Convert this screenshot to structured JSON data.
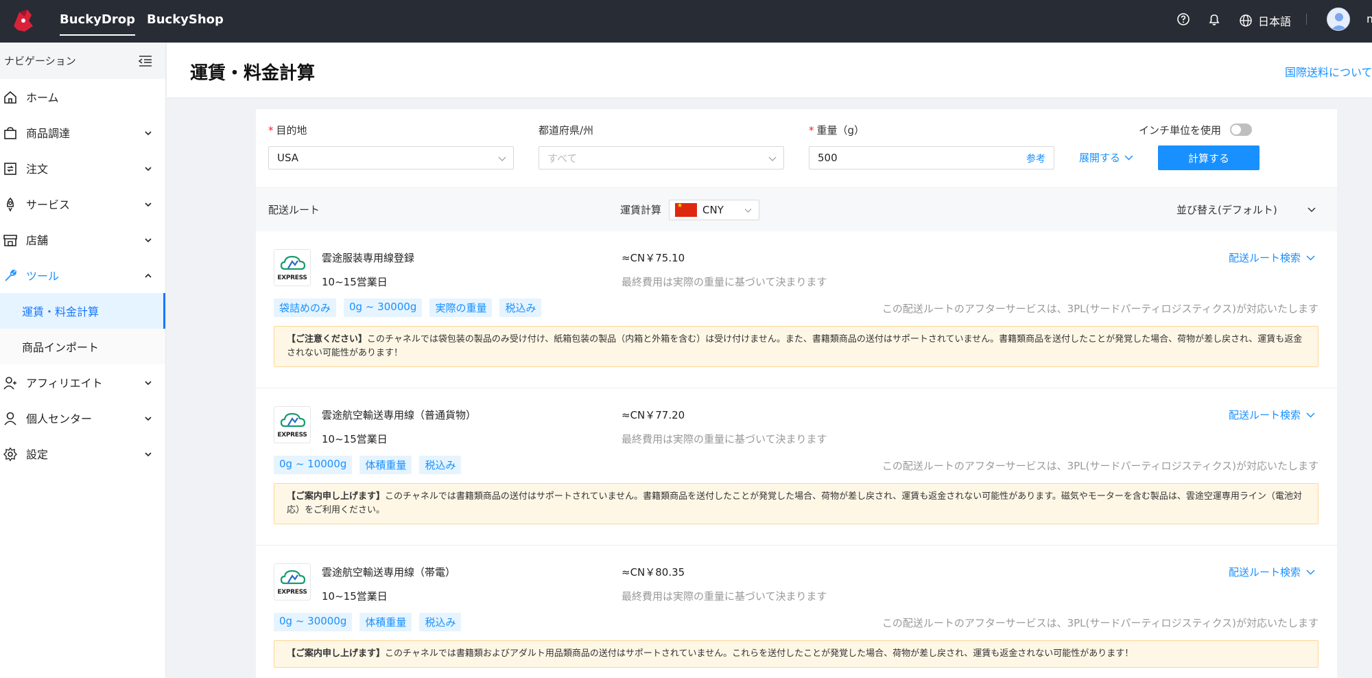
{
  "topbar": {
    "tabs": [
      {
        "label": "BuckyDrop"
      },
      {
        "label": "BuckyShop"
      }
    ],
    "language": "日本語",
    "user_initial": "m"
  },
  "sidebar": {
    "header": "ナビゲーション",
    "items": [
      {
        "label": "ホーム",
        "icon": "home-icon"
      },
      {
        "label": "商品調達",
        "icon": "shopping-bag-icon"
      },
      {
        "label": "注文",
        "icon": "order-icon"
      },
      {
        "label": "サービス",
        "icon": "rocket-icon"
      },
      {
        "label": "店舗",
        "icon": "store-icon"
      },
      {
        "label": "ツール",
        "icon": "wrench-icon"
      },
      {
        "label": "アフィリエイト",
        "icon": "affiliate-icon"
      },
      {
        "label": "個人センター",
        "icon": "user-icon"
      },
      {
        "label": "設定",
        "icon": "gear-icon"
      }
    ],
    "tools_sub": [
      {
        "label": "運賃・料金計算"
      },
      {
        "label": "商品インポート"
      }
    ]
  },
  "header": {
    "title": "運賃・料金計算",
    "link": "国際送料について書"
  },
  "form": {
    "destination_label": "目的地",
    "destination_value": "USA",
    "state_label": "都道府県/州",
    "state_placeholder": "すべて",
    "weight_label": "重量（g）",
    "weight_value": "500",
    "weight_ref": "参考",
    "inch_label": "インチ単位を使用",
    "expand_label": "展開する",
    "calc_button": "計算する"
  },
  "table": {
    "route_header": "配送ルート",
    "fee_header": "運賃計算",
    "currency": "CNY",
    "sort_label": "並び替え(デフォルト)"
  },
  "routes": [
    {
      "name": "雲途服装専用線登録",
      "days": "10~15営業日",
      "price": "≈CN￥75.10",
      "note": "最終費用は実際の重量に基づいて決まります",
      "search": "配送ルート検索",
      "tags": [
        "袋詰めのみ",
        "0g ~ 30000g",
        "実際の重量",
        "税込み"
      ],
      "after_service": "この配送ルートのアフターサービスは、3PL(サードパーティロジスティクス)が対応いたします",
      "notice_title": "【ご注意ください】",
      "notice_text": "このチャネルでは袋包装の製品のみ受け付け、紙箱包装の製品（内箱と外箱を含む）は受け付けません。また、書籍類商品の送付はサポートされていません。書籍類商品を送付したことが発覚した場合、荷物が差し戻され、運賃も返金されない可能性があります！",
      "logo_text": "EXPRESS"
    },
    {
      "name": "雲途航空輸送専用線（普通貨物）",
      "days": "10~15営業日",
      "price": "≈CN￥77.20",
      "note": "最終費用は実際の重量に基づいて決まります",
      "search": "配送ルート検索",
      "tags": [
        "0g ~ 10000g",
        "体積重量",
        "税込み"
      ],
      "after_service": "この配送ルートのアフターサービスは、3PL(サードパーティロジスティクス)が対応いたします",
      "notice_title": "【ご案内申し上げます】",
      "notice_text": "このチャネルでは書籍類商品の送付はサポートされていません。書籍類商品を送付したことが発覚した場合、荷物が差し戻され、運賃も返金されない可能性があります。磁気やモーターを含む製品は、雲途空運専用ライン（電池対応）をご利用ください。",
      "logo_text": "EXPRESS"
    },
    {
      "name": "雲途航空輸送専用線（帯電）",
      "days": "10~15営業日",
      "price": "≈CN￥80.35",
      "note": "最終費用は実際の重量に基づいて決まります",
      "search": "配送ルート検索",
      "tags": [
        "0g ~ 30000g",
        "体積重量",
        "税込み"
      ],
      "after_service": "この配送ルートのアフターサービスは、3PL(サードパーティロジスティクス)が対応いたします",
      "notice_title": "【ご案内申し上げます】",
      "notice_text": "このチャネルでは書籍類およびアダルト用品類商品の送付はサポートされていません。これらを送付したことが発覚した場合、荷物が差し戻され、運賃も返金されない可能性があります！",
      "logo_text": "EXPRESS"
    }
  ],
  "colors": {
    "accent": "#1890ff",
    "topbar": "#282c34",
    "notice_bg": "#fff7e6",
    "required": "#f5222d"
  }
}
